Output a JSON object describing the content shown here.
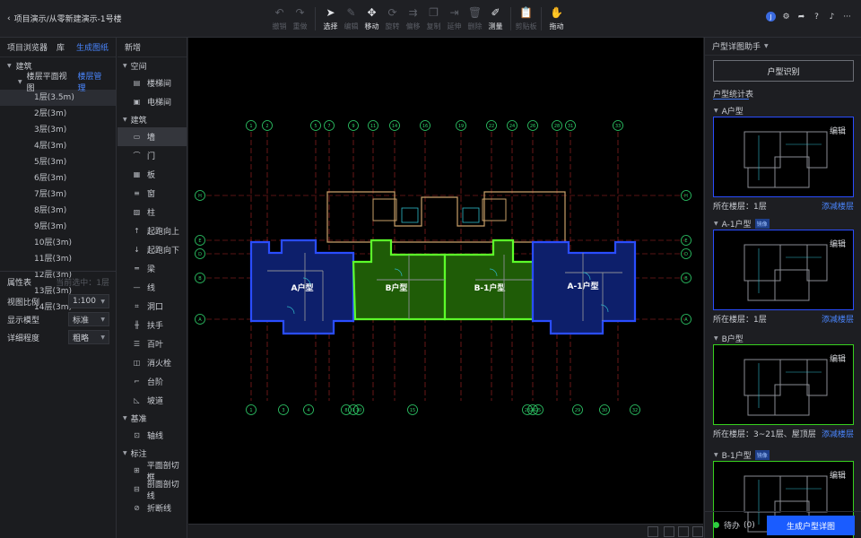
{
  "header": {
    "breadcrumb": "项目演示/从零新建演示-1号楼",
    "tools": [
      {
        "label": "撤销",
        "icon": "undo-icon",
        "enabled": false
      },
      {
        "label": "重做",
        "icon": "redo-icon",
        "enabled": false
      },
      {
        "label": "选择",
        "icon": "cursor-icon",
        "enabled": true
      },
      {
        "label": "编辑",
        "icon": "pen-icon",
        "enabled": false
      },
      {
        "label": "移动",
        "icon": "move-icon",
        "enabled": true
      },
      {
        "label": "旋转",
        "icon": "rotate-icon",
        "enabled": false
      },
      {
        "label": "偏移",
        "icon": "offset-icon",
        "enabled": false
      },
      {
        "label": "复制",
        "icon": "copy-icon",
        "enabled": false
      },
      {
        "label": "延伸",
        "icon": "extend-icon",
        "enabled": false
      },
      {
        "label": "删除",
        "icon": "trash-icon",
        "enabled": false
      },
      {
        "label": "测量",
        "icon": "ruler-icon",
        "enabled": true
      },
      {
        "label": "剪贴板",
        "icon": "clipboard-icon",
        "enabled": false
      },
      {
        "label": "拖动",
        "icon": "hand-icon",
        "enabled": true
      }
    ],
    "user_initial": "J"
  },
  "left_panel": {
    "tab_browser": "项目浏览器",
    "tab_library": "库",
    "generate_drawing": "生成图纸",
    "root": "建筑",
    "floorplan_view": "楼层平面视图",
    "floor_manage": "楼层管理",
    "floors": [
      "1层(3.5m)",
      "2层(3m)",
      "3层(3m)",
      "4层(3m)",
      "5层(3m)",
      "6层(3m)",
      "7层(3m)",
      "8层(3m)",
      "9层(3m)",
      "10层(3m)",
      "11层(3m)",
      "12层(3m)",
      "13层(3m)",
      "14层(3m)"
    ],
    "selected_floor": "1层(3.5m)"
  },
  "properties": {
    "title": "属性表",
    "selection_hint": "当前选中：1层",
    "rows": [
      {
        "label": "视图比例",
        "value": "1:100"
      },
      {
        "label": "显示模型",
        "value": "标准"
      },
      {
        "label": "详细程度",
        "value": "粗略"
      }
    ]
  },
  "components": {
    "title": "新增",
    "groups": [
      {
        "name": "空间",
        "items": [
          {
            "label": "楼梯间",
            "icon": "stair-room-icon"
          },
          {
            "label": "电梯间",
            "icon": "elevator-icon"
          }
        ]
      },
      {
        "name": "建筑",
        "items": [
          {
            "label": "墙",
            "icon": "wall-icon",
            "selected": true
          },
          {
            "label": "门",
            "icon": "door-icon"
          },
          {
            "label": "板",
            "icon": "slab-icon"
          },
          {
            "label": "窗",
            "icon": "window-icon"
          },
          {
            "label": "柱",
            "icon": "column-icon"
          },
          {
            "label": "起跑向上",
            "icon": "stair-up-icon"
          },
          {
            "label": "起跑向下",
            "icon": "stair-down-icon"
          },
          {
            "label": "梁",
            "icon": "beam-icon"
          },
          {
            "label": "线",
            "icon": "line-icon"
          },
          {
            "label": "洞口",
            "icon": "opening-icon"
          },
          {
            "label": "扶手",
            "icon": "railing-icon"
          },
          {
            "label": "百叶",
            "icon": "louver-icon"
          },
          {
            "label": "消火栓",
            "icon": "hydrant-icon"
          },
          {
            "label": "台阶",
            "icon": "steps-icon"
          },
          {
            "label": "坡道",
            "icon": "ramp-icon"
          }
        ]
      },
      {
        "name": "基准",
        "items": [
          {
            "label": "轴线",
            "icon": "axis-icon"
          }
        ]
      },
      {
        "name": "标注",
        "items": [
          {
            "label": "平面剖切框",
            "icon": "section-box-icon"
          },
          {
            "label": "剖面剖切线",
            "icon": "section-line-icon"
          },
          {
            "label": "折断线",
            "icon": "break-line-icon"
          }
        ]
      }
    ]
  },
  "canvas": {
    "units": [
      {
        "label": "A户型",
        "fill": "#0d1f6b",
        "stroke": "#2a4dff"
      },
      {
        "label": "B户型",
        "fill": "#1f5c07",
        "stroke": "#5cff2a"
      },
      {
        "label": "B-1户型",
        "fill": "#1f5c07",
        "stroke": "#5cff2a"
      },
      {
        "label": "A-1户型",
        "fill": "#0d1f6b",
        "stroke": "#2a4dff"
      }
    ],
    "top_axes": [
      "1",
      "2",
      "5",
      "7",
      "9",
      "11",
      "14",
      "16",
      "19",
      "22",
      "24",
      "26",
      "28",
      "31",
      "33"
    ],
    "bottom_axes": [
      "1",
      "3",
      "4",
      "8",
      "9",
      "10",
      "15",
      "23",
      "24",
      "25",
      "29",
      "30",
      "32"
    ],
    "row_axes": [
      "H",
      "E",
      "D",
      "B",
      "A"
    ]
  },
  "right_panel": {
    "title": "户型详图助手",
    "identify_button": "户型识别",
    "stats_title": "户型统计表",
    "edit_label": "编辑",
    "floor_prefix": "所在楼层：",
    "add_remove_floors": "添减楼层",
    "mirror_badge": "镜像",
    "units": [
      {
        "name": "A户型",
        "mirror": false,
        "floors": "1层",
        "frame": "#2a4dff"
      },
      {
        "name": "A-1户型",
        "mirror": true,
        "floors": "1层",
        "frame": "#2a4dff"
      },
      {
        "name": "B户型",
        "mirror": false,
        "floors": "3~21层、屋顶层",
        "frame": "#37d11e"
      },
      {
        "name": "B-1户型",
        "mirror": true,
        "floors": "",
        "frame": "#37d11e"
      }
    ],
    "pending_label": "待办",
    "pending_count": "(0)",
    "generate_button": "生成户型详图"
  }
}
